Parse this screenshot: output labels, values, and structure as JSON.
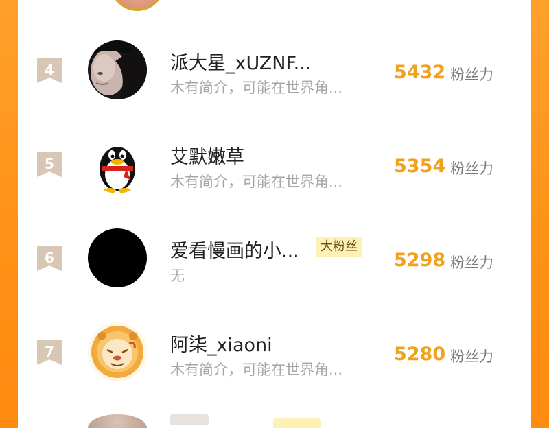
{
  "leaderboard": {
    "rows": [
      {
        "rank": "4",
        "name": "派大星_xUZNF...",
        "intro": "木有简介，可能在世界角...",
        "score": "5432",
        "score_label": "粉丝力",
        "badge": ""
      },
      {
        "rank": "5",
        "name": "艾默嫩草",
        "intro": "木有简介，可能在世界角...",
        "score": "5354",
        "score_label": "粉丝力",
        "badge": ""
      },
      {
        "rank": "6",
        "name": "爱看慢画的小...",
        "intro": "无",
        "score": "5298",
        "score_label": "粉丝力",
        "badge": "大粉丝"
      },
      {
        "rank": "7",
        "name": "阿柒_xiaoni",
        "intro": "木有简介，可能在世界角...",
        "score": "5280",
        "score_label": "粉丝力",
        "badge": ""
      }
    ]
  },
  "colors": {
    "frame": "#ff9a20",
    "score": "#f0a21f",
    "rank_bg": "#d9c7b6",
    "badge_bg": "#fdf1b6"
  },
  "icons": {
    "row4_avatar": "portrait-photo",
    "row5_avatar": "penguin-icon",
    "row6_avatar": "black-circle",
    "row7_avatar": "lion-cartoon-icon"
  }
}
